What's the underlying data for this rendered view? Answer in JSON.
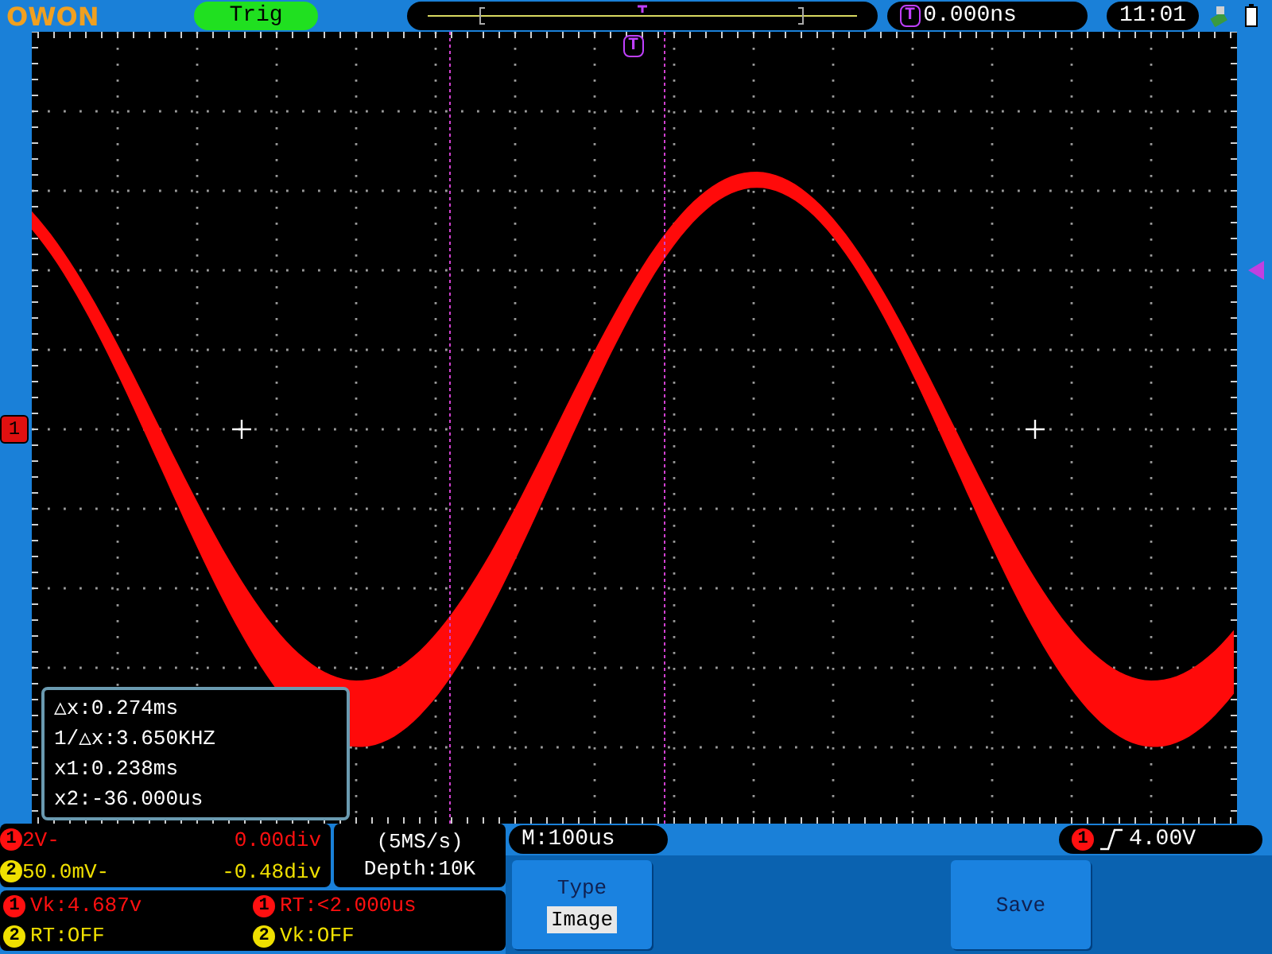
{
  "top_bar": {
    "logo": "OWON",
    "trigger_status": "Trig",
    "trigger_marker": "T",
    "trigger_position": "0.000ns",
    "time": "11:01"
  },
  "screen": {
    "trigger_marker": "T",
    "channel_marker": "1",
    "cursor_readout": [
      "△x:0.274ms",
      "1/△x:3.650KHZ",
      "x1:0.238ms",
      "x2:-36.000us"
    ]
  },
  "channels": [
    {
      "label": "1",
      "color": "#ff1010",
      "scale": "2V-",
      "offset": "0.00div"
    },
    {
      "label": "2",
      "color": "#f0e000",
      "scale": "50.0mV-",
      "offset": "-0.48div"
    }
  ],
  "acquisition": {
    "sample_rate": "(5MS/s)",
    "depth": "Depth:10K"
  },
  "measurements": [
    {
      "label": "1",
      "color": "#ff1010",
      "text": "Vk:4.687v"
    },
    {
      "label": "1",
      "color": "#ff1010",
      "text": "RT:<2.000us"
    },
    {
      "label": "2",
      "color": "#f0e000",
      "text": "RT:OFF"
    },
    {
      "label": "2",
      "color": "#f0e000",
      "text": "Vk:OFF"
    }
  ],
  "timebase": "M:100us",
  "trigger": {
    "label": "1",
    "level": "4.00V"
  },
  "menu": [
    {
      "kind": "option",
      "title": "Type",
      "value": "Image"
    },
    {
      "kind": "action",
      "label": "Save"
    }
  ]
}
